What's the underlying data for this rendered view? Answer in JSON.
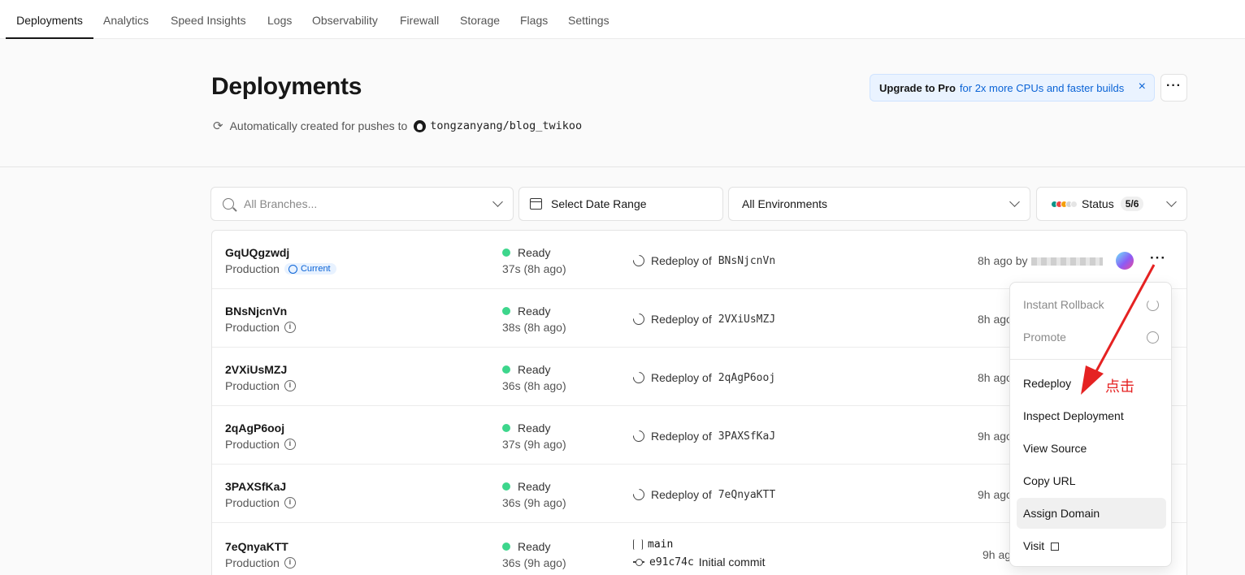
{
  "nav": {
    "tabs": [
      "Deployments",
      "Analytics",
      "Speed Insights",
      "Logs",
      "Observability",
      "Firewall",
      "Storage",
      "Flags",
      "Settings"
    ],
    "active": "Deployments"
  },
  "header": {
    "title": "Deployments",
    "subtitle": "Automatically created for pushes to",
    "repo": "tongzanyang/blog_twikoo",
    "upgrade_bold": "Upgrade to Pro",
    "upgrade_text": "for 2x more CPUs and faster builds",
    "close_icon": "×",
    "more_icon": "···"
  },
  "filters": {
    "branches_placeholder": "All Branches...",
    "date_range": "Select Date Range",
    "environments": "All Environments",
    "status_label": "Status",
    "status_count": "5/6",
    "status_dots": [
      "#0d9488",
      "#ef4444",
      "#f59e0b",
      "#d4d4d4",
      "#e5e5e5"
    ]
  },
  "deployments": [
    {
      "id": "GqUQgzwdj",
      "env": "Production",
      "current": "Current",
      "status": "Ready",
      "duration": "37s (8h ago)",
      "commit_prefix": "Redeploy of",
      "commit_ref": "BNsNjcnVn",
      "time": "8h ago by",
      "user": "yang 7110"
    },
    {
      "id": "BNsNjcnVn",
      "env": "Production",
      "status": "Ready",
      "duration": "38s (8h ago)",
      "commit_prefix": "Redeploy of",
      "commit_ref": "2VXiUsMZJ",
      "time": "8h ago"
    },
    {
      "id": "2VXiUsMZJ",
      "env": "Production",
      "status": "Ready",
      "duration": "36s (8h ago)",
      "commit_prefix": "Redeploy of",
      "commit_ref": "2qAgP6ooj",
      "time": "8h ago"
    },
    {
      "id": "2qAgP6ooj",
      "env": "Production",
      "status": "Ready",
      "duration": "37s (9h ago)",
      "commit_prefix": "Redeploy of",
      "commit_ref": "3PAXSfKaJ",
      "time": "9h ago"
    },
    {
      "id": "3PAXSfKaJ",
      "env": "Production",
      "status": "Ready",
      "duration": "36s (9h ago)",
      "commit_prefix": "Redeploy of",
      "commit_ref": "7eQnyaKTT",
      "time": "9h ago"
    },
    {
      "id": "7eQnyaKTT",
      "env": "Production",
      "status": "Ready",
      "duration": "36s (9h ago)",
      "branch": "main",
      "commit_hash": "e91c74c",
      "commit_msg": "Initial commit",
      "time": "9h ago"
    }
  ],
  "status_color": "#3dd68c",
  "menu": {
    "items": [
      "Instant Rollback",
      "Promote",
      "Redeploy",
      "Inspect Deployment",
      "View Source",
      "Copy URL",
      "Assign Domain",
      "Visit"
    ],
    "highlighted": "Assign Domain"
  },
  "annotation": "点击",
  "annotation_color": "#e52222"
}
